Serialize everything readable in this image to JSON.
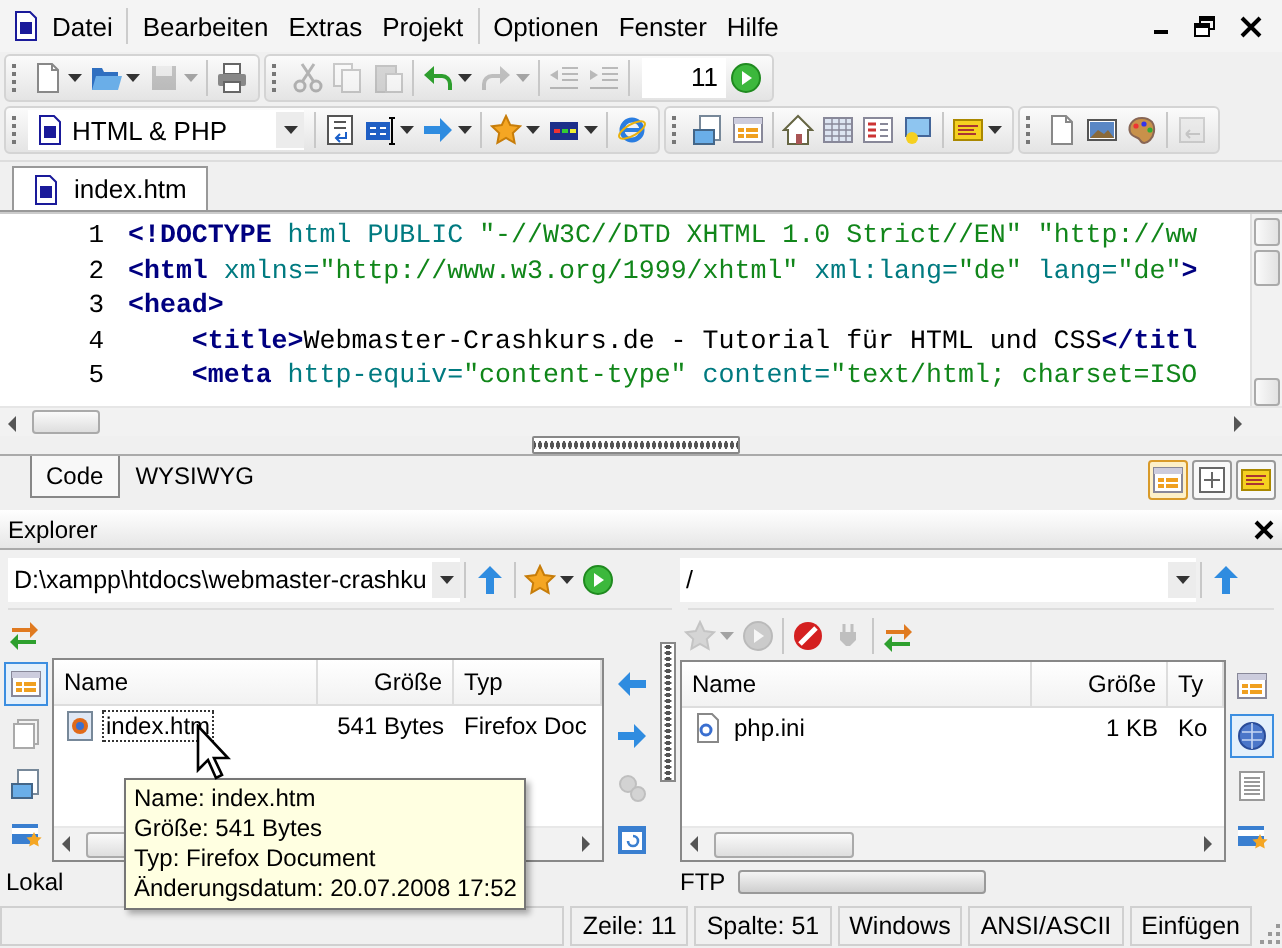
{
  "menu_bar": {
    "items": [
      "Datei",
      "Bearbeiten",
      "Extras",
      "Projekt",
      "Optionen",
      "Fenster",
      "Hilfe"
    ]
  },
  "toolbar_1": {
    "bands": [
      {
        "groups": [
          [
            {
              "kind": "button",
              "disabled": false,
              "menu": true
            },
            {
              "kind": "button",
              "disabled": false,
              "menu": true
            },
            {
              "kind": "button",
              "disabled": true,
              "menu": true
            }
          ],
          [
            {
              "kind": "button",
              "disabled": false,
              "menu": false
            }
          ]
        ]
      },
      {
        "groups": [
          [
            {
              "kind": "button",
              "disabled": true,
              "menu": false
            },
            {
              "kind": "button",
              "disabled": true,
              "menu": false
            },
            {
              "kind": "button",
              "disabled": true,
              "menu": false
            }
          ],
          [
            {
              "kind": "button",
              "disabled": false,
              "menu": true
            },
            {
              "kind": "button",
              "disabled": true,
              "menu": true
            }
          ],
          [
            {
              "kind": "button",
              "disabled": true,
              "menu": false
            },
            {
              "kind": "button",
              "disabled": true,
              "menu": false
            }
          ],
          [
            {
              "kind": "field",
              "value": "11"
            },
            {
              "kind": "button",
              "disabled": false,
              "menu": false
            }
          ]
        ]
      }
    ]
  },
  "toolbar_2": {
    "bands": [
      {
        "groups": [
          [
            {
              "kind": "combo",
              "value": "HTML & PHP"
            }
          ],
          [
            {
              "kind": "button",
              "disabled": false,
              "menu": false
            },
            {
              "kind": "button",
              "disabled": false,
              "menu": true
            },
            {
              "kind": "button",
              "disabled": false,
              "menu": true
            }
          ],
          [
            {
              "kind": "button",
              "disabled": false,
              "menu": true
            },
            {
              "kind": "button",
              "disabled": false,
              "menu": true
            }
          ],
          [
            {
              "kind": "button",
              "disabled": false,
              "menu": false
            }
          ]
        ]
      },
      {
        "groups": [
          [
            {
              "kind": "button",
              "disabled": false,
              "menu": false
            },
            {
              "kind": "button",
              "disabled": false,
              "menu": false
            }
          ],
          [
            {
              "kind": "button",
              "disabled": false,
              "menu": false
            },
            {
              "kind": "button",
              "disabled": false,
              "menu": false
            },
            {
              "kind": "button",
              "disabled": false,
              "menu": false
            },
            {
              "kind": "button",
              "disabled": false,
              "menu": false
            }
          ],
          [
            {
              "kind": "button",
              "disabled": false,
              "menu": true
            }
          ]
        ]
      },
      {
        "groups": [
          [
            {
              "kind": "button",
              "disabled": false,
              "menu": false
            },
            {
              "kind": "button",
              "disabled": false,
              "menu": false
            },
            {
              "kind": "button",
              "disabled": false,
              "menu": false
            }
          ],
          [
            {
              "kind": "button",
              "disabled": true,
              "menu": false
            }
          ]
        ]
      }
    ]
  },
  "document_tabs": [
    {
      "label": "index.htm",
      "selected": true
    }
  ],
  "editor": {
    "lines": [
      {
        "number": "1",
        "indent": false,
        "tokens": [
          {
            "kind": "tag",
            "text": "<!DOCTYPE"
          },
          {
            "kind": "attr",
            "text": " html PUBLIC "
          },
          {
            "kind": "value",
            "text": "\"-//W3C//DTD XHTML 1.0 Strict//EN\""
          },
          {
            "kind": "value",
            "text": " \"http://ww"
          }
        ]
      },
      {
        "number": "2",
        "indent": false,
        "tokens": [
          {
            "kind": "tag",
            "text": "<html"
          },
          {
            "kind": "attr",
            "text": " xmlns="
          },
          {
            "kind": "value",
            "text": "\"http://www.w3.org/1999/xhtml\""
          },
          {
            "kind": "attr",
            "text": " xml:lang="
          },
          {
            "kind": "value",
            "text": "\"de\""
          },
          {
            "kind": "attr",
            "text": " lang="
          },
          {
            "kind": "value",
            "text": "\"de\""
          },
          {
            "kind": "tag",
            "text": ">"
          }
        ]
      },
      {
        "number": "3",
        "indent": false,
        "tokens": [
          {
            "kind": "tag",
            "text": "<head>"
          }
        ]
      },
      {
        "number": "4",
        "indent": true,
        "tokens": [
          {
            "kind": "tag",
            "text": "<title>"
          },
          {
            "kind": "text",
            "text": "Webmaster-Crashkurs.de - Tutorial für HTML und CSS"
          },
          {
            "kind": "tag",
            "text": "</titl"
          }
        ]
      },
      {
        "number": "5",
        "indent": true,
        "tokens": [
          {
            "kind": "tag",
            "text": "<meta"
          },
          {
            "kind": "attr",
            "text": " http-equiv="
          },
          {
            "kind": "value",
            "text": "\"content-type\""
          },
          {
            "kind": "attr",
            "text": " content="
          },
          {
            "kind": "value",
            "text": "\"text/html; charset=ISO"
          }
        ]
      }
    ]
  },
  "editor_tabs": [
    {
      "label": "Code",
      "selected": true
    },
    {
      "label": "WYSIWYG",
      "selected": false
    }
  ],
  "view_buttons": [
    {
      "selected": true
    },
    {
      "selected": false
    },
    {
      "selected": false
    }
  ],
  "explorer": {
    "title": "Explorer",
    "local": {
      "path_bar": {
        "groups": [
          [
            {
              "kind": "path",
              "value": "D:\\xampp\\htdocs\\webmaster-crashku"
            }
          ],
          [
            {
              "kind": "button",
              "disabled": false,
              "menu": false
            }
          ],
          [
            {
              "kind": "button",
              "disabled": false,
              "menu": true
            },
            {
              "kind": "button",
              "disabled": false,
              "menu": false
            }
          ]
        ]
      },
      "toolbar": {
        "groups": [
          [
            {
              "kind": "button",
              "disabled": false,
              "menu": false
            }
          ]
        ]
      },
      "side_buttons": [
        {
          "selected": true
        },
        {
          "selected": false
        },
        {
          "selected": false
        },
        {
          "selected": false
        }
      ],
      "columns": [
        "Name",
        "Größe",
        "Typ"
      ],
      "rows": [
        {
          "name": "index.htm",
          "size": "541 Bytes",
          "type": "Firefox Doc",
          "selected": true
        }
      ],
      "label": "Lokal",
      "tooltip": [
        "Name: index.htm",
        "Größe: 541 Bytes",
        "Typ: Firefox Document",
        "Änderungsdatum: 20.07.2008 17:52"
      ]
    },
    "transfer_buttons": [
      {
        "disabled": false
      },
      {
        "disabled": false
      },
      {
        "disabled": true
      },
      {
        "disabled": false
      }
    ],
    "remote": {
      "path_bar": {
        "groups": [
          [
            {
              "kind": "path",
              "value": "/"
            }
          ],
          [
            {
              "kind": "button",
              "disabled": false,
              "menu": false
            }
          ]
        ]
      },
      "toolbar": {
        "groups": [
          [
            {
              "kind": "button",
              "disabled": true,
              "menu": true
            },
            {
              "kind": "button",
              "disabled": true,
              "menu": false
            }
          ],
          [
            {
              "kind": "button",
              "disabled": false,
              "menu": false
            },
            {
              "kind": "button",
              "disabled": true,
              "menu": false
            }
          ],
          [
            {
              "kind": "button",
              "disabled": false,
              "menu": false
            }
          ]
        ]
      },
      "side_buttons": [
        {
          "selected": false
        },
        {
          "selected": true
        },
        {
          "selected": false
        },
        {
          "selected": false
        }
      ],
      "columns": [
        "Name",
        "Größe",
        "Ty"
      ],
      "rows": [
        {
          "name": "php.ini",
          "size": "1 KB",
          "type": "Ko",
          "selected": false
        }
      ],
      "label": "FTP",
      "transfer": {
        "level": 0
      }
    }
  },
  "status_bar": {
    "panels": [
      "Zeile: 11",
      "Spalte: 51",
      "Windows",
      "ANSI/ASCII",
      "Einfügen"
    ]
  }
}
